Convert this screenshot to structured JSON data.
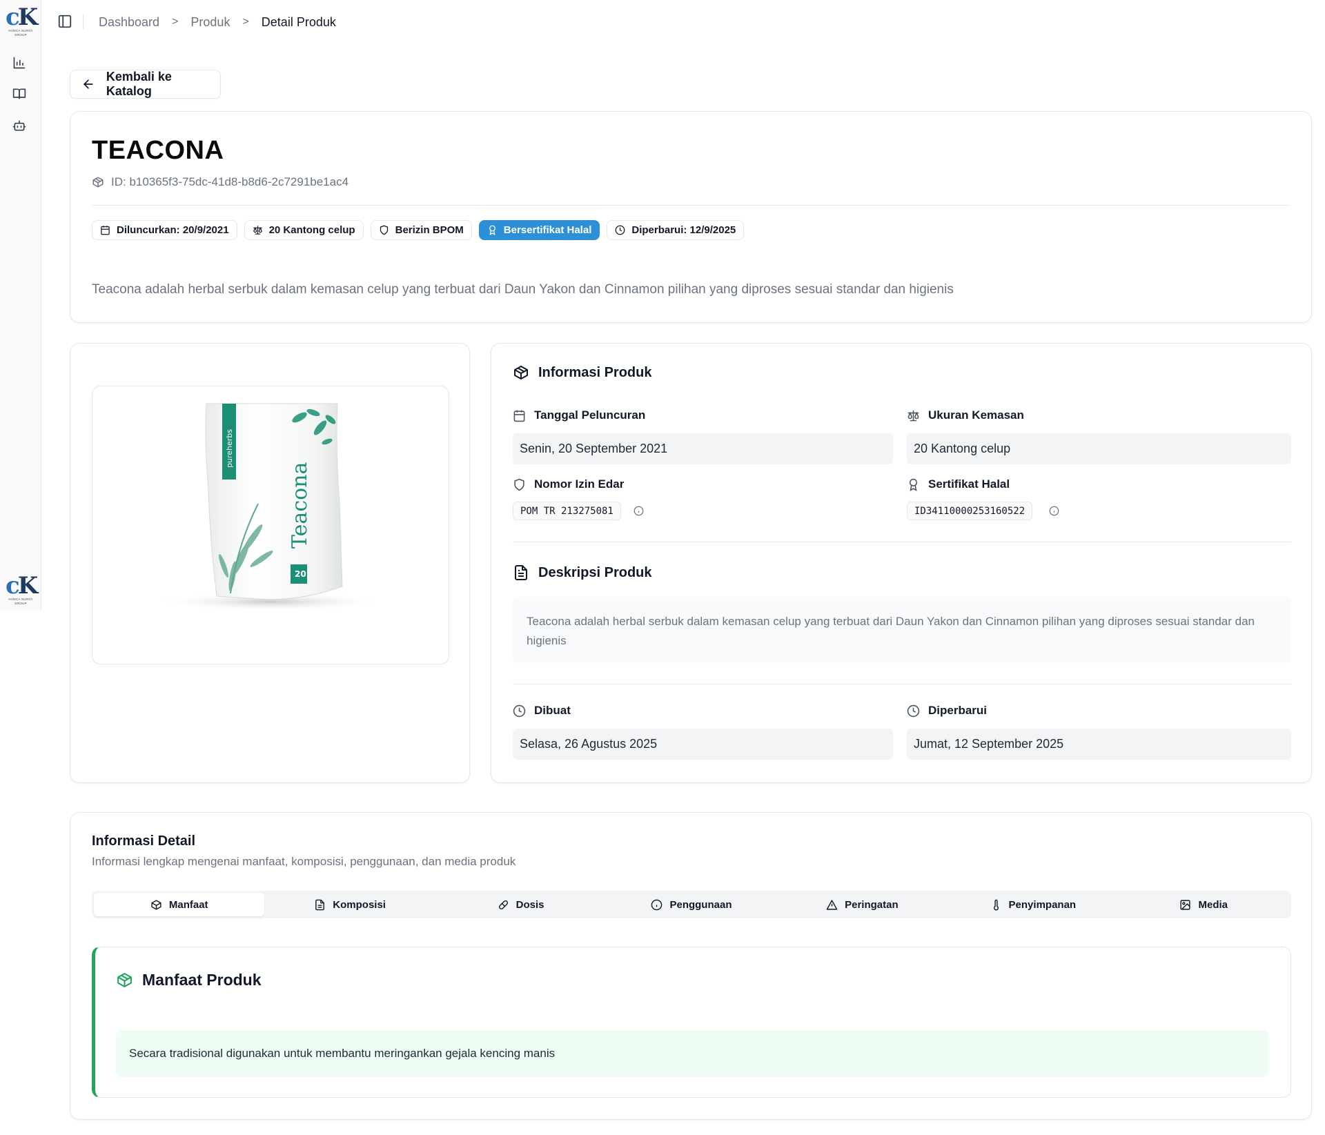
{
  "sidebar": {
    "logo_text": "HANCA SURYA GROUP",
    "items": [
      {
        "name": "chart-icon"
      },
      {
        "name": "book-icon"
      },
      {
        "name": "bot-icon"
      }
    ]
  },
  "breadcrumb": {
    "items": [
      "Dashboard",
      "Produk"
    ],
    "current": "Detail Produk",
    "separator": ">"
  },
  "back_button": "Kembali ke Katalog",
  "product": {
    "name": "TEACONA",
    "id_text": "ID: b10365f3-75dc-41d8-b8d6-2c7291be1ac4",
    "badges": [
      {
        "label": "Diluncurkan: 20/9/2021",
        "icon": "calendar-icon"
      },
      {
        "label": "20 Kantong celup",
        "icon": "scale-icon"
      },
      {
        "label": "Berizin BPOM",
        "icon": "shield-icon"
      },
      {
        "label": "Bersertifikat Halal",
        "icon": "award-icon",
        "highlight": true
      },
      {
        "label": "Diperbarui: 12/9/2025",
        "icon": "clock-icon"
      }
    ],
    "description": "Teacona adalah herbal serbuk dalam kemasan celup yang terbuat dari Daun Yakon dan Cinnamon pilihan yang diproses sesuai standar dan higienis"
  },
  "image": {
    "brand_side": "pureherbs",
    "brand_name": "Teacona",
    "pack_count": "20"
  },
  "info": {
    "title": "Informasi Produk",
    "launch_label": "Tanggal Peluncuran",
    "launch_value": "Senin, 20 September 2021",
    "size_label": "Ukuran Kemasan",
    "size_value": "20 Kantong celup",
    "permit_label": "Nomor Izin Edar",
    "permit_value": "POM TR 213275081",
    "halal_label": "Sertifikat Halal",
    "halal_value": "ID34110000253160522",
    "desc_title": "Deskripsi Produk",
    "desc_text": "Teacona adalah herbal serbuk dalam kemasan celup yang terbuat dari Daun Yakon dan Cinnamon pilihan yang diproses sesuai standar dan higienis",
    "created_label": "Dibuat",
    "created_value": "Selasa, 26 Agustus 2025",
    "updated_label": "Diperbarui",
    "updated_value": "Jumat, 12 September 2025"
  },
  "detail": {
    "title": "Informasi Detail",
    "subtitle": "Informasi lengkap mengenai manfaat, komposisi, penggunaan, dan media produk",
    "tabs": [
      {
        "label": "Manfaat",
        "icon": "box-icon",
        "active": true
      },
      {
        "label": "Komposisi",
        "icon": "file-icon"
      },
      {
        "label": "Dosis",
        "icon": "pill-icon"
      },
      {
        "label": "Penggunaan",
        "icon": "info-icon"
      },
      {
        "label": "Peringatan",
        "icon": "warning-icon"
      },
      {
        "label": "Penyimpanan",
        "icon": "thermometer-icon"
      },
      {
        "label": "Media",
        "icon": "image-icon"
      }
    ],
    "benefit_title": "Manfaat Produk",
    "benefits": [
      "Secara tradisional digunakan untuk membantu meringankan gejala kencing manis"
    ]
  },
  "colors": {
    "accent_blue": "#2d8fd5",
    "benefit_green": "#22a55b",
    "brand_teal": "#1a8f76"
  }
}
